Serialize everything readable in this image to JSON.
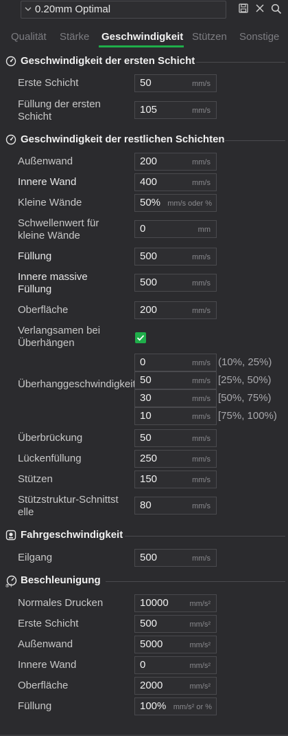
{
  "preset": {
    "name": "0.20mm Optimal"
  },
  "tabs": [
    {
      "label": "Qualität"
    },
    {
      "label": "Stärke"
    },
    {
      "label": "Geschwindigkeit"
    },
    {
      "label": "Stützen"
    },
    {
      "label": "Sonstige"
    }
  ],
  "sections": {
    "first_layer": {
      "title": "Geschwindigkeit der ersten Schicht",
      "rows": [
        {
          "label": "Erste Schicht",
          "value": "50",
          "unit": "mm/s"
        },
        {
          "label": "Füllung der ersten Schicht",
          "value": "105",
          "unit": "mm/s"
        }
      ]
    },
    "other_layers": {
      "title": "Geschwindigkeit der restlichen Schichten",
      "rows": [
        {
          "label": "Außenwand",
          "value": "200",
          "unit": "mm/s"
        },
        {
          "label": "Innere Wand",
          "value": "400",
          "unit": "mm/s"
        },
        {
          "label": "Kleine Wände",
          "value": "50%",
          "unit": "mm/s oder %"
        },
        {
          "label": "Schwellenwert für kleine Wände",
          "value": "0",
          "unit": "mm"
        },
        {
          "label": "Füllung",
          "value": "500",
          "unit": "mm/s"
        },
        {
          "label": "Innere massive Füllung",
          "value": "500",
          "unit": "mm/s"
        },
        {
          "label": "Oberfläche",
          "value": "200",
          "unit": "mm/s"
        }
      ],
      "slow_down_label": "Verlangsamen bei Überhängen",
      "slow_down_checked": true,
      "overhang_label": "Überhanggeschwindigkeit",
      "overhang_rows": [
        {
          "value": "0",
          "unit": "mm/s",
          "range": "(10%, 25%)"
        },
        {
          "value": "50",
          "unit": "mm/s",
          "range": "[25%, 50%)"
        },
        {
          "value": "30",
          "unit": "mm/s",
          "range": "[50%, 75%)"
        },
        {
          "value": "10",
          "unit": "mm/s",
          "range": "[75%, 100%)"
        }
      ],
      "rows2": [
        {
          "label": "Überbrückung",
          "value": "50",
          "unit": "mm/s"
        },
        {
          "label": "Lückenfüllung",
          "value": "250",
          "unit": "mm/s"
        },
        {
          "label": "Stützen",
          "value": "150",
          "unit": "mm/s"
        },
        {
          "label": "Stützstruktur-Schnittstelle",
          "value": "80",
          "unit": "mm/s"
        }
      ]
    },
    "travel": {
      "title": "Fahrgeschwindigkeit",
      "rows": [
        {
          "label": "Eilgang",
          "value": "500",
          "unit": "mm/s"
        }
      ]
    },
    "acceleration": {
      "title": "Beschleunigung",
      "rows": [
        {
          "label": "Normales Drucken",
          "value": "10000",
          "unit": "mm/s²"
        },
        {
          "label": "Erste Schicht",
          "value": "500",
          "unit": "mm/s²"
        },
        {
          "label": "Außenwand",
          "value": "5000",
          "unit": "mm/s²"
        },
        {
          "label": "Innere Wand",
          "value": "0",
          "unit": "mm/s²"
        },
        {
          "label": "Oberfläche",
          "value": "2000",
          "unit": "mm/s²"
        },
        {
          "label": "Füllung",
          "value": "100%",
          "unit": "mm/s² or %"
        }
      ]
    }
  }
}
